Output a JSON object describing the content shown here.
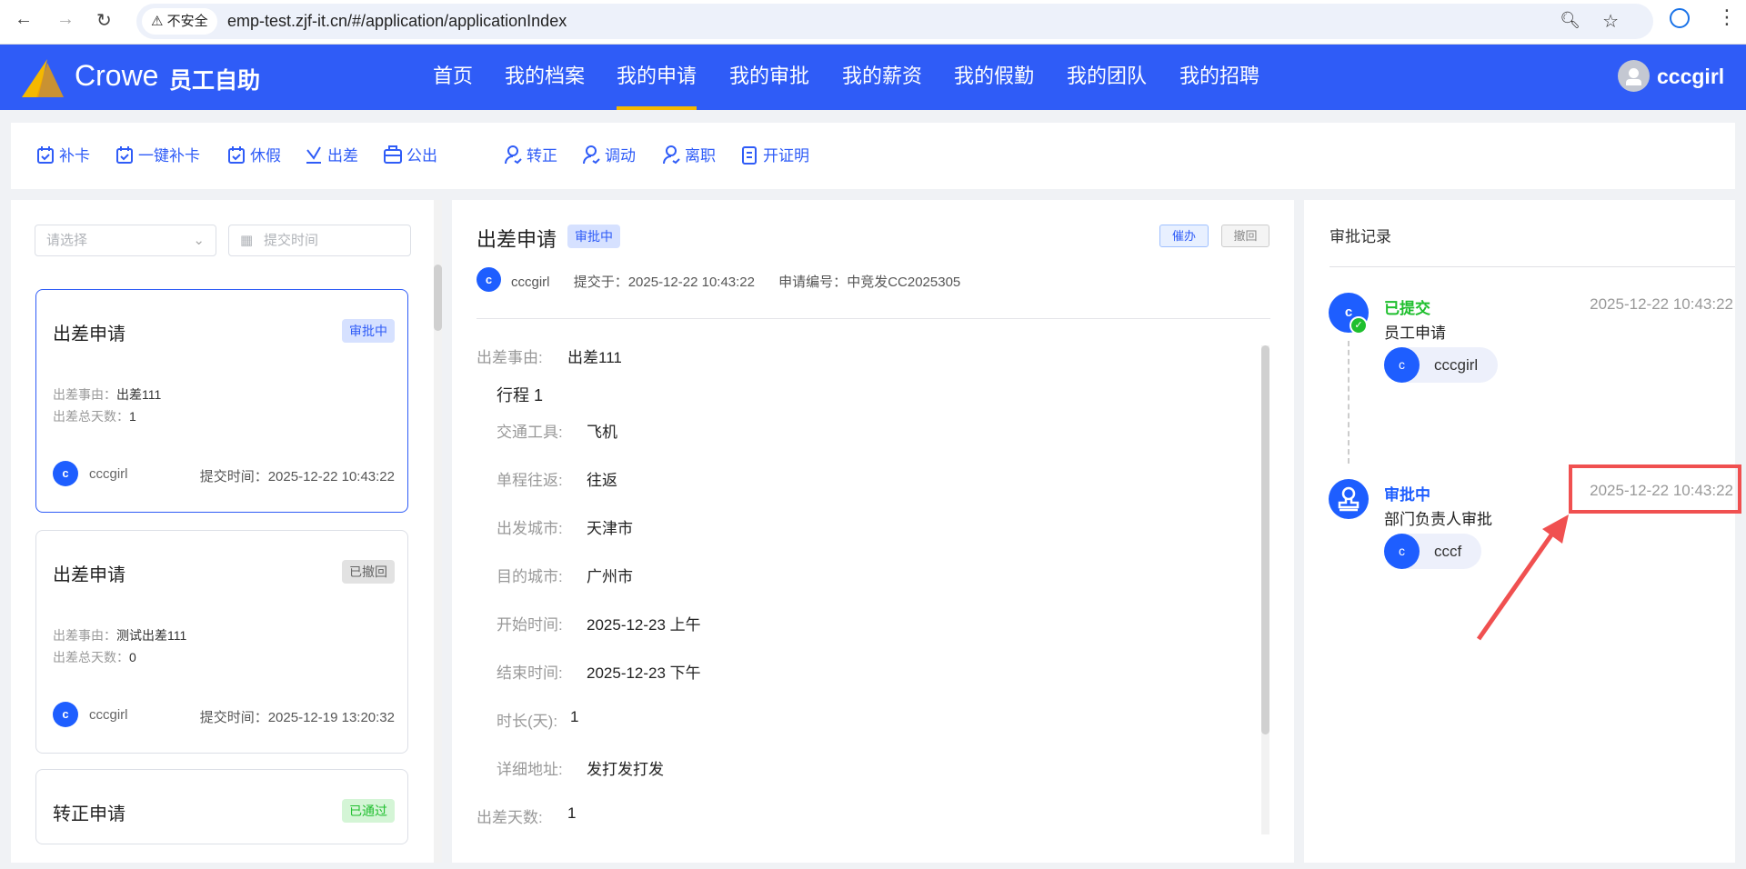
{
  "browser": {
    "security": "不安全",
    "url": "emp-test.zjf-it.cn/#/application/applicationIndex"
  },
  "header": {
    "brand": "Crowe",
    "app": "员工自助",
    "user": "cccgirl",
    "nav": [
      "首页",
      "我的档案",
      "我的申请",
      "我的审批",
      "我的薪资",
      "我的假勤",
      "我的团队",
      "我的招聘"
    ],
    "active_index": 2
  },
  "toolbar": [
    "补卡",
    "一键补卡",
    "休假",
    "出差",
    "公出",
    "转正",
    "调动",
    "离职",
    "开证明"
  ],
  "filters": {
    "select_placeholder": "请选择",
    "date_placeholder": "提交时间"
  },
  "list": [
    {
      "title": "出差申请",
      "status": "审批中",
      "reason_label": "出差事由：",
      "reason": "出差111",
      "days_label": "出差总天数：",
      "days": "1",
      "user": "cccgirl",
      "avatar": "c",
      "time_label": "提交时间：",
      "time": "2025-12-22 10:43:22"
    },
    {
      "title": "出差申请",
      "status": "已撤回",
      "reason_label": "出差事由：",
      "reason": "测试出差111",
      "days_label": "出差总天数：",
      "days": "0",
      "user": "cccgirl",
      "avatar": "c",
      "time_label": "提交时间：",
      "time": "2025-12-19 13:20:32"
    },
    {
      "title": "转正申请",
      "status": "已通过"
    }
  ],
  "detail": {
    "title": "出差申请",
    "status": "审批中",
    "urge": "催办",
    "withdraw": "撤回",
    "user": "cccgirl",
    "avatar": "c",
    "submit_label": "提交于：",
    "submit_time": "2025-12-22 10:43:22",
    "no_label": "申请编号：",
    "no": "中竞发CC2025305",
    "reason_label": "出差事由:",
    "reason": "出差111",
    "trip_title": "行程 1",
    "rows": [
      [
        "交通工具:",
        "飞机"
      ],
      [
        "单程往返:",
        "往返"
      ],
      [
        "出发城市:",
        "天津市"
      ],
      [
        "目的城市:",
        "广州市"
      ],
      [
        "开始时间:",
        "2025-12-23 上午"
      ],
      [
        "结束时间:",
        "2025-12-23 下午"
      ],
      [
        "时长(天):",
        "1"
      ],
      [
        "详细地址:",
        "发打发打发"
      ]
    ],
    "days_label": "出差天数:",
    "days": "1"
  },
  "records": {
    "title": "审批记录",
    "items": [
      {
        "status": "已提交",
        "step": "员工申请",
        "time": "2025-12-22 10:43:22",
        "person": "cccgirl",
        "avatar": "c",
        "color": "#1fbf2e"
      },
      {
        "status": "审批中",
        "step": "部门负责人审批",
        "time": "2025-12-22 10:43:22",
        "person": "cccf",
        "avatar": "c",
        "color": "#1e5eff"
      }
    ]
  }
}
